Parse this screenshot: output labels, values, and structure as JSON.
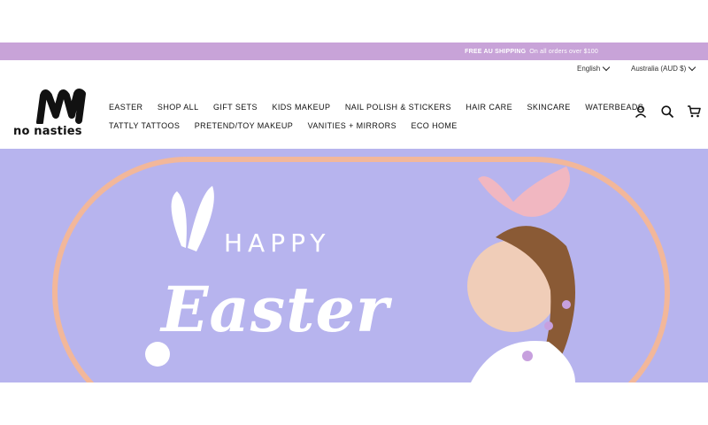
{
  "announcement": {
    "strong": "FREE AU SHIPPING",
    "text": "On all orders over $100"
  },
  "utility": {
    "language": "English",
    "currency": "Australia (AUD $)"
  },
  "brand": {
    "logo_text": "no nasties"
  },
  "nav": {
    "row1": [
      "EASTER",
      "SHOP ALL",
      "GIFT SETS",
      "KIDS MAKEUP",
      "NAIL POLISH & STICKERS",
      "HAIR CARE",
      "SKINCARE",
      "WATERBEADS"
    ],
    "row2": [
      "TATTLY TATTOOS",
      "PRETEND/TOY MAKEUP",
      "VANITIES + MIRRORS",
      "ECO HOME"
    ]
  },
  "header_icons": [
    "account-icon",
    "search-icon",
    "cart-icon"
  ],
  "hero": {
    "happy": "HAPPY",
    "easter": "Easter",
    "bg_color": "#b7b4ee",
    "frame_color": "#f2b79a"
  },
  "colors": {
    "announcement_bar": "#c8a3d8"
  }
}
